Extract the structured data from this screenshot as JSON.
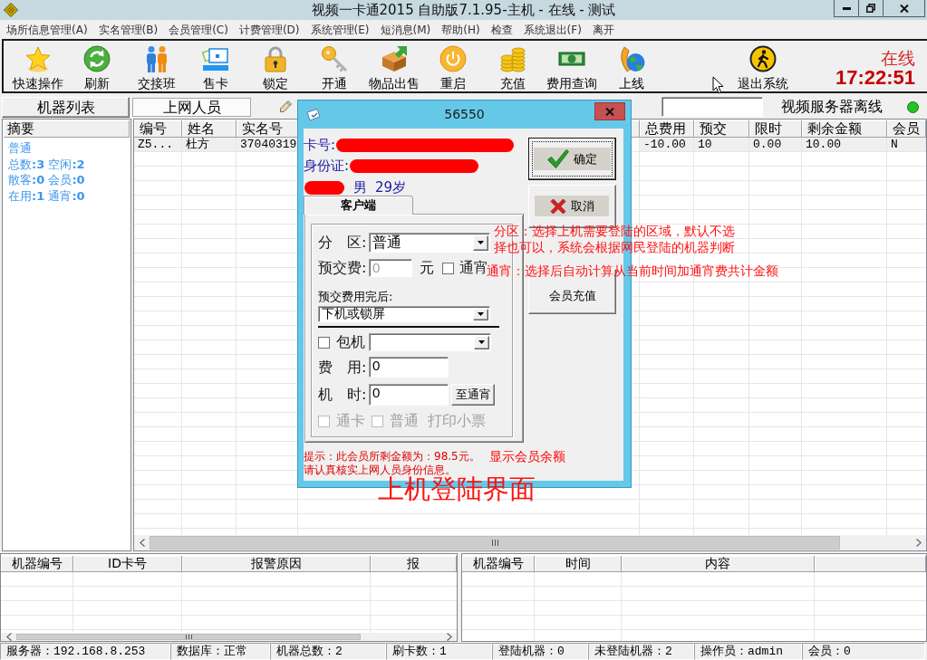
{
  "window": {
    "title": "视频一卡通2015 自助版7.1.95-主机 - 在线 - 测试"
  },
  "menu": [
    "场所信息管理(A)",
    "实名管理(B)",
    "会员管理(C)",
    "计费管理(D)",
    "系统管理(E)",
    "短消息(M)",
    "帮助(H)",
    "检查",
    "系统退出(F)",
    "离开"
  ],
  "toolbar": {
    "buttons": [
      {
        "label": "快速操作"
      },
      {
        "label": "刷新"
      },
      {
        "label": "交接班"
      },
      {
        "label": "售卡"
      },
      {
        "label": "锁定"
      },
      {
        "label": "开通"
      },
      {
        "label": "物品出售"
      },
      {
        "label": "重启"
      },
      {
        "label": "充值"
      },
      {
        "label": "费用查询"
      },
      {
        "label": "上线"
      }
    ],
    "exit_button": {
      "label": "退出系统"
    },
    "status": "在线",
    "clock": "17:22:51"
  },
  "tabs": [
    {
      "label": "机器列表",
      "selected": false
    },
    {
      "label": "上网人员",
      "selected": true
    }
  ],
  "video_server_status": "视频服务器离线",
  "summary": {
    "header": "摘要",
    "lines": [
      "普通",
      "总数**:3** 空闲**:2**",
      "散客**:0** 会员**:0**",
      "在用**:1** 通宵**:0**"
    ]
  },
  "table": {
    "columns": [
      "编号",
      "姓名",
      "实名号",
      "总费用",
      "预交",
      "限时",
      "剩余金额",
      "会员"
    ],
    "rows": [
      {
        "cells": [
          "Z5...",
          "杜方",
          "37040319",
          "-10.00",
          "10",
          "0.00",
          "10.00",
          "N"
        ],
        "selected": true
      }
    ]
  },
  "dialog": {
    "title": "56550",
    "card_no": {
      "label": "卡号:",
      "redacted": true
    },
    "id_card": {
      "label": "身份证:",
      "redacted": true
    },
    "person": {
      "name_redacted": true,
      "gender": "男",
      "age": "29岁"
    },
    "tabs": [
      {
        "label": "客户端",
        "selected": true
      }
    ],
    "zone": {
      "label": "分　区:",
      "value": "普通"
    },
    "prepay": {
      "label": "预交费:",
      "value": "0",
      "unit": "元",
      "disabled": true
    },
    "overnight": {
      "label": "通宵",
      "checked": false
    },
    "after_prepay": {
      "label": "预交费用完后:",
      "value": "下机或锁屏"
    },
    "package": {
      "label": "包机",
      "checked": false
    },
    "fee": {
      "label": "费　用:",
      "value": "0"
    },
    "duration": {
      "label": "机　时:",
      "value": "0",
      "button": "至通宵"
    },
    "options": [
      {
        "label": "通卡",
        "checked": false,
        "disabled": true
      },
      {
        "label": "普通",
        "checked": false,
        "disabled": true
      }
    ],
    "print_receipt": {
      "label": "打印小票",
      "disabled": true
    },
    "hints": [
      "提示：此会员所剩金额为：98.5元。",
      "请认真核实上网人员身份信息。"
    ],
    "buttons": [
      {
        "label": "确定",
        "kind": "ok"
      },
      {
        "label": "取消",
        "kind": "cancel"
      },
      {
        "label": "会员充值",
        "kind": "plain"
      }
    ]
  },
  "annotations": {
    "zone_note": "分区：选择上机需要登陆的区域，默认不选择也可以，系统会根据网民登陆的机器判断",
    "overnight_note": "通宵：选择后自动计算从当前时间加通宵费共计金额",
    "balance_note": "显示会员余额",
    "caption": "上机登陆界面"
  },
  "alarm_table": {
    "columns": [
      "机器编号",
      "ID卡号",
      "报警原因",
      "报"
    ]
  },
  "message_table": {
    "columns": [
      "机器编号",
      "时间",
      "内容"
    ]
  },
  "status_bar": [
    "服务器：192.168.8.253",
    "数据库：正常",
    "机器总数：2",
    "刷卡数：1",
    "登陆机器：0",
    "未登陆机器：2",
    "操作员：admin",
    "会员：0"
  ]
}
